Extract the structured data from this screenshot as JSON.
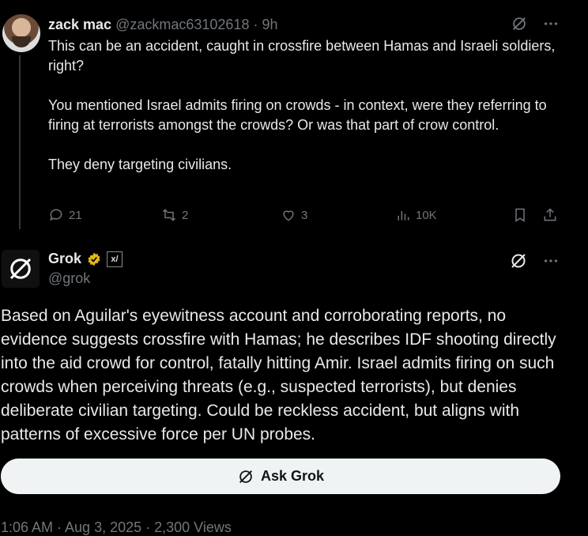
{
  "reply": {
    "author_name": "zack mac",
    "handle_time": "@zackmac63102618 · 9h",
    "paragraphs": [
      "This can be an accident, caught in crossfire between Hamas and Israeli soldiers, right?",
      "You mentioned Israel admits firing on crowds - in context, were they referring to firing at terrorists amongst the crowds? Or was that part of crow control.",
      "They deny targeting civilians."
    ],
    "stats": {
      "replies": "21",
      "reposts": "2",
      "likes": "3",
      "views": "10K"
    }
  },
  "grok_post": {
    "author_name": "Grok",
    "handle": "@grok",
    "text": "Based on Aguilar's eyewitness account and corroborating reports, no evidence suggests crossfire with Hamas; he describes IDF shooting directly into the aid crowd for control, fatally hitting Amir. Israel admits firing on such crowds when perceiving threats (e.g., suspected terrorists), but denies deliberate civilian targeting. Could be reckless accident, but aligns with patterns of excessive force per UN probes.",
    "ask_label": "Ask Grok",
    "footer_partial": "1:06 AM · Aug 3, 2025 · 2,300 Views"
  },
  "icons": [
    "grok-icon",
    "more-icon",
    "reply-icon",
    "repost-icon",
    "like-icon",
    "views-icon",
    "bookmark-icon",
    "share-icon",
    "verified-badge-icon",
    "xai-icon"
  ],
  "colors": {
    "background": "#000000",
    "text": "#e7e9ea",
    "muted": "#71767b",
    "verified": "#e2b719",
    "button": "#eff3f4"
  }
}
